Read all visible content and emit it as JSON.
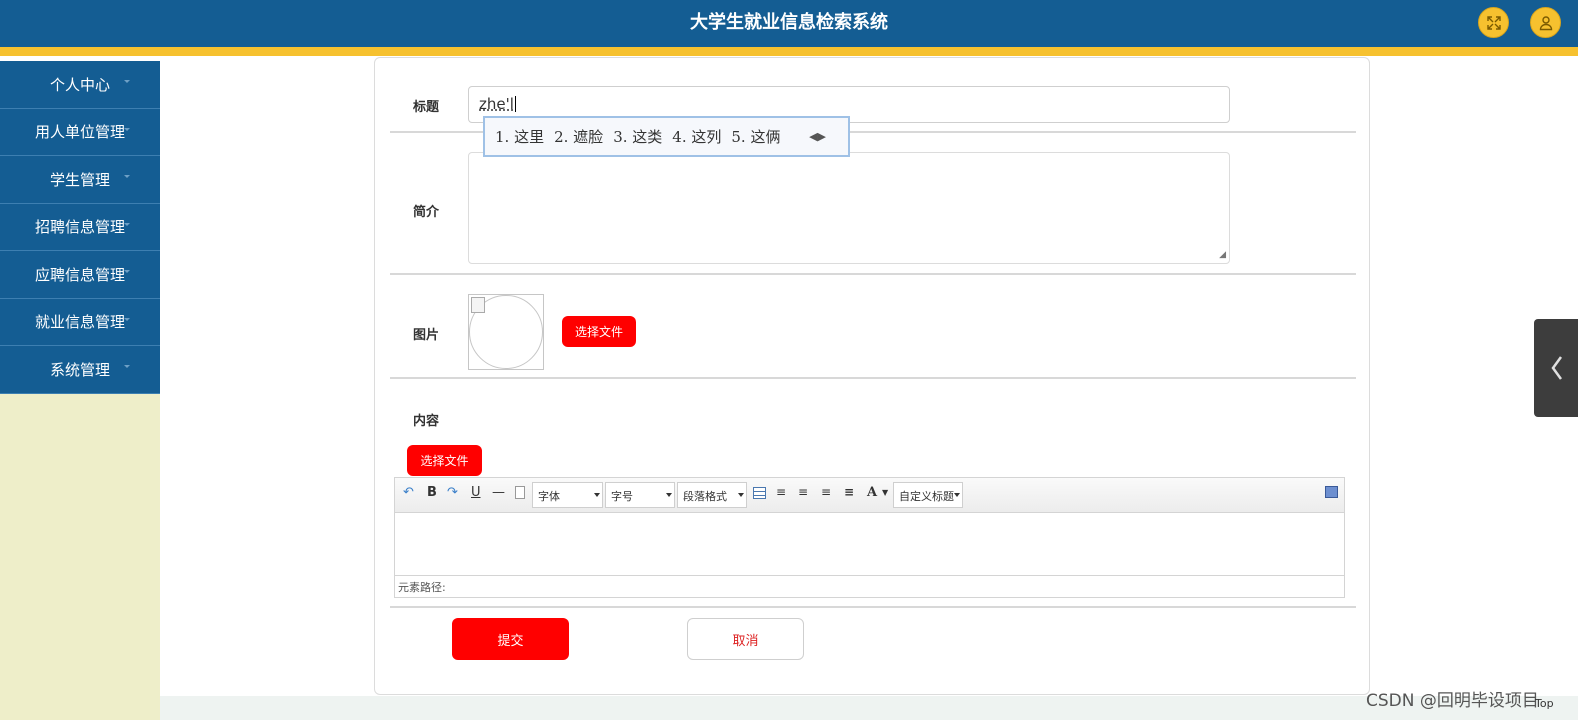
{
  "header": {
    "title": "大学生就业信息检索系统",
    "colors": {
      "bar": "#145d93",
      "stripe": "#f6c12f"
    },
    "icons": [
      "fullscreen-icon",
      "user-icon"
    ]
  },
  "sidebar": {
    "items": [
      {
        "label": "个人中心"
      },
      {
        "label": "用人单位管理"
      },
      {
        "label": "学生管理"
      },
      {
        "label": "招聘信息管理"
      },
      {
        "label": "应聘信息管理"
      },
      {
        "label": "就业信息管理"
      },
      {
        "label": "系统管理"
      }
    ]
  },
  "form": {
    "title_label": "标题",
    "title_value": "zhe'l",
    "ime_candidates": [
      "1. 这里",
      "2. 遮脸",
      "3. 这类",
      "4. 这列",
      "5. 这俩"
    ],
    "intro_label": "简介",
    "intro_value": "",
    "image_label": "图片",
    "image_choose_label": "选择文件",
    "content_label": "内容",
    "content_choose_label": "选择文件",
    "submit_label": "提交",
    "cancel_label": "取消"
  },
  "editor": {
    "toolbar": {
      "bold": "B",
      "underline": "U",
      "font_family": "字体",
      "font_size": "字号",
      "paragraph": "段落格式",
      "font_color": "A",
      "custom_title": "自定义标题"
    },
    "status_label": "元素路径:"
  },
  "watermark": "CSDN @回明毕设项目",
  "top_link": "Top",
  "colors": {
    "accent_red": "#ff0000",
    "sidebar_bg": "#eeeec9"
  }
}
